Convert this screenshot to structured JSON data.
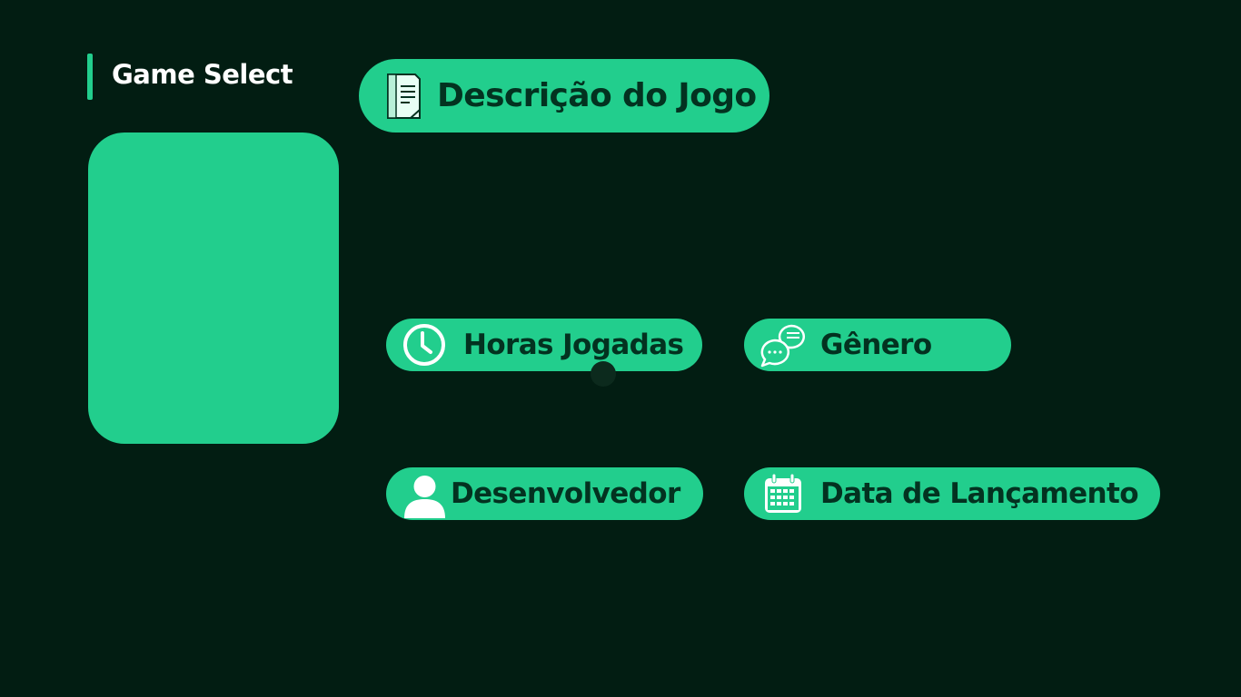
{
  "brand": {
    "title": "Game Select"
  },
  "description": {
    "label": "Descrição do Jogo",
    "icon": "document-icon"
  },
  "stats": {
    "hours": {
      "label": "Horas Jogadas",
      "icon": "clock-icon"
    },
    "genre": {
      "label": "Gênero",
      "icon": "chat-bubbles-icon"
    },
    "developer": {
      "label": "Desenvolvedor",
      "icon": "user-icon"
    },
    "release_date": {
      "label": "Data de Lançamento",
      "icon": "calendar-icon"
    }
  },
  "colors": {
    "background": "#021d12",
    "accent": "#22ce8d",
    "text_on_accent": "#033220",
    "title": "#ffffff"
  }
}
